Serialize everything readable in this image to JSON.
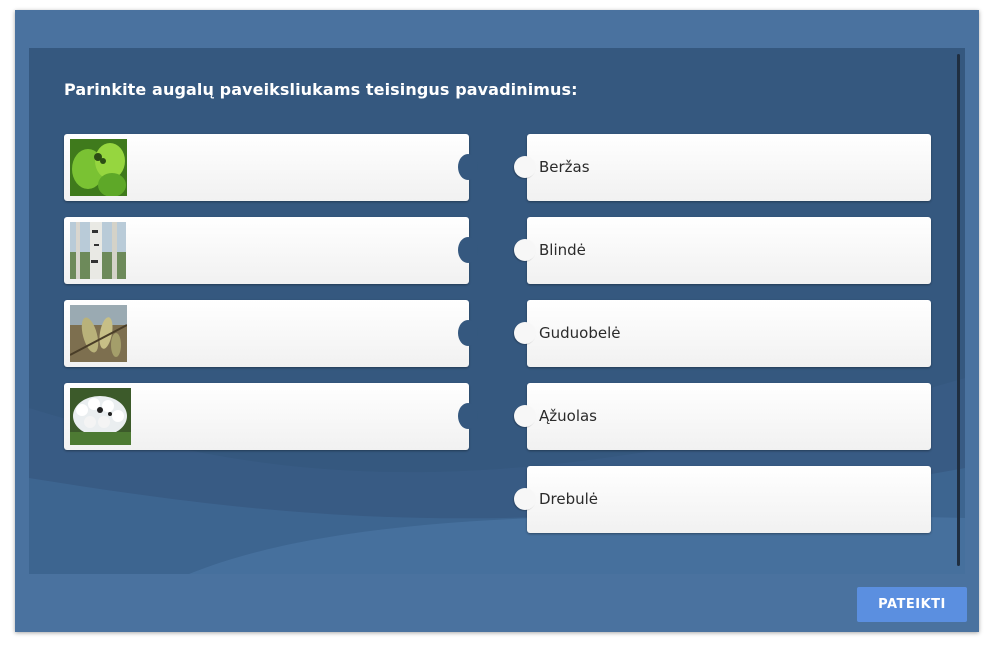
{
  "question": "Parinkite augalų paveiksliukams teisingus pavadinimus:",
  "images": [
    {
      "icon": "leaves-photo",
      "alt": "green leaves"
    },
    {
      "icon": "birch-trunk-photo",
      "alt": "birch trunk"
    },
    {
      "icon": "willow-catkins-photo",
      "alt": "catkins"
    },
    {
      "icon": "white-flowers-photo",
      "alt": "white blossoms"
    }
  ],
  "answers": [
    "Beržas",
    "Blindė",
    "Guduobelė",
    "Ąžuolas",
    "Drebulė"
  ],
  "submit_label": "PATEIKTI",
  "colors": {
    "frame": "#4a729f",
    "stage": "#35587f",
    "button": "#5b8fe0"
  }
}
